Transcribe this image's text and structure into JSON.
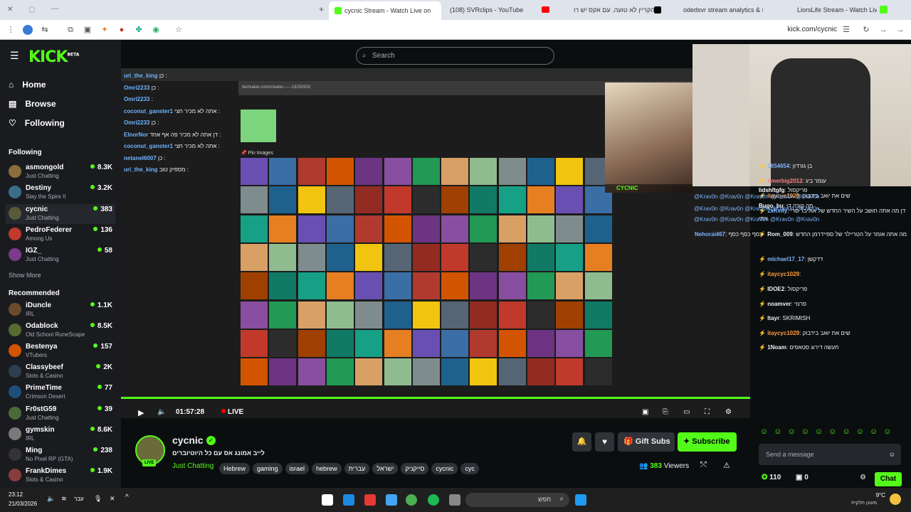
{
  "browser": {
    "tabs": [
      {
        "title": "cycnic Stream - Watch Live on",
        "color": "#53fc18",
        "active": true
      },
      {
        "title": "(108) SVRclips - YouTube",
        "color": "#ff0000"
      },
      {
        "title": "הקריין לא טועה. עם אקס יש רו",
        "color": "#000000"
      },
      {
        "title": "odedsvr stream analytics & sta",
        "color": "#3b5bdb"
      },
      {
        "title": "LiorsLife Stream - Watch Live o",
        "color": "#53fc18"
      }
    ],
    "url": "kick.com/cycnic"
  },
  "site": {
    "logo": "KICK",
    "logo_sup": "BETA",
    "search_placeholder": "Search"
  },
  "sidebar": {
    "nav": [
      {
        "label": "Home",
        "icon": "home-icon"
      },
      {
        "label": "Browse",
        "icon": "browse-icon"
      },
      {
        "label": "Following",
        "icon": "heart-icon"
      }
    ],
    "following_title": "Following",
    "following": [
      {
        "name": "asmongold",
        "category": "Just Chatting",
        "viewers": "8.3K",
        "color": "#8a6d3b"
      },
      {
        "name": "Destiny",
        "category": "Slay the Spire II",
        "viewers": "3.2K",
        "color": "#3b6d8a"
      },
      {
        "name": "cycnic",
        "category": "Just Chatting",
        "viewers": "383",
        "color": "#5a5a3a"
      },
      {
        "name": "PedroFederer",
        "category": "Among Us",
        "viewers": "136",
        "color": "#c0392b"
      },
      {
        "name": "IGZ_",
        "category": "Just Chatting",
        "viewers": "58",
        "color": "#7b3b8a"
      }
    ],
    "show_more": "Show More",
    "recommended_title": "Recommended",
    "recommended": [
      {
        "name": "iDuncle",
        "category": "IRL",
        "viewers": "1.1K",
        "color": "#6b4b2b"
      },
      {
        "name": "Odablock",
        "category": "Old School RuneScape",
        "viewers": "8.5K",
        "color": "#556b2f"
      },
      {
        "name": "Bestenya",
        "category": "VTubers",
        "viewers": "157",
        "color": "#d35400"
      },
      {
        "name": "Classybeef",
        "category": "Slots & Casino",
        "viewers": "2K",
        "color": "#2c3e50"
      },
      {
        "name": "PrimeTime",
        "category": "Crimson Desert",
        "viewers": "77",
        "color": "#1f4e79"
      },
      {
        "name": "Fr0stG59",
        "category": "Just Chatting",
        "viewers": "39",
        "color": "#4a6a3a"
      },
      {
        "name": "gymskin",
        "category": "IRL",
        "viewers": "8.6K",
        "color": "#7a7a7a"
      },
      {
        "name": "Ming",
        "category": "No Pixel RP (GTA)",
        "viewers": "238",
        "color": "#333333"
      },
      {
        "name": "FrankDimes",
        "category": "Slots & Casino",
        "viewers": "1.9K",
        "color": "#8a3b3b"
      }
    ]
  },
  "video": {
    "time": "01:57:28",
    "live": "LIVE",
    "inner_chat": [
      {
        "user": "uri_the_king",
        "text": "כן :"
      },
      {
        "user": "Omri2233",
        "text": "כן :"
      },
      {
        "user": "Omri2233",
        "text": ":"
      },
      {
        "user": "coconut_ganster1",
        "text": "אתה לא מכיר חצי :"
      },
      {
        "user": "Omri2233",
        "text": "כן :"
      },
      {
        "user": "ElnorNor",
        "text": "דן אתה לא מכיר פה אף אחד :"
      },
      {
        "user": "coconut_ganster1",
        "text": "אתה לא מכיר חצי :"
      },
      {
        "user": "netanel6007",
        "text": "כן :"
      },
      {
        "user": "uri_the_king",
        "text": "מספיק טוב :"
      }
    ],
    "tier_label": "Pin Images",
    "cam_label": "CYCNIC"
  },
  "stream": {
    "name": "cycnic",
    "title": "לייב אמונג אס עם כל היוטיוברים",
    "category": "Just Chatting",
    "tags": [
      "Hebrew",
      "gaming",
      "israel",
      "hebrew",
      "עברית",
      "ישראל",
      "סייקניק",
      "cycnic",
      "cyc"
    ],
    "gift_subs": "Gift Subs",
    "subscribe": "Subscribe",
    "viewers": "383",
    "viewers_label": "Viewers",
    "live_badge": "LIVE"
  },
  "chat": {
    "overlay": [
      {
        "user": "lidshftgfg",
        "text": "פריקסול"
      },
      {
        "user": "Bugo_bu",
        "text": "מה קורה דן"
      },
      {
        "user": "Nehorai467",
        "text": "כסף כסף כסף"
      }
    ],
    "mentions": "@Krav0n @Krav0n @Krav0n @Krav0n @Krav0n",
    "messages": [
      {
        "user": "1654654",
        "text": "בן גורדון",
        "color": "#7fb3ff"
      },
      {
        "user": "omerbig2012",
        "text": "עומר ביג",
        "color": "#ff7f7f"
      },
      {
        "user": "itaycyc1029",
        "text": "שים את יואב בידבוק",
        "color": "#ff9f3f"
      },
      {
        "user": "2xKelly",
        "text": "דן מה אתה חושב על השיר החדש של אוליבר סרי אתי",
        "color": "#7fb3ff"
      },
      {
        "user": "Rom_009",
        "text": "מה אתה אומר על הטריילר של ספיידרמן החדש",
        "color": "#efeff1"
      },
      {
        "user": "michael17_17",
        "text": "דדקשן",
        "color": "#7fb3ff"
      },
      {
        "user": "itaycyc1029",
        "text": "",
        "color": "#ff9f3f"
      },
      {
        "user": "IDOE2",
        "text": "פריקסול",
        "color": "#efeff1"
      },
      {
        "user": "noamver",
        "text": "פרנזי",
        "color": "#efeff1"
      },
      {
        "user": "Itayr",
        "text": "SKRIMISH",
        "color": "#efeff1"
      },
      {
        "user": "itaycyc1029",
        "text": "שים את יואב בידבוק",
        "color": "#ff9f3f"
      },
      {
        "user": "1Noam",
        "text": "תעשה דירוג סטאפים",
        "color": "#efeff1"
      }
    ],
    "placeholder": "Send a message",
    "points": "110",
    "count": "0",
    "chat_button": "Chat"
  },
  "taskbar": {
    "time": "23:12",
    "date": "21/03/2026",
    "lang": "עבר",
    "search": "חפש",
    "weather": "9°C",
    "weather_desc": "מעונן חלקית"
  }
}
